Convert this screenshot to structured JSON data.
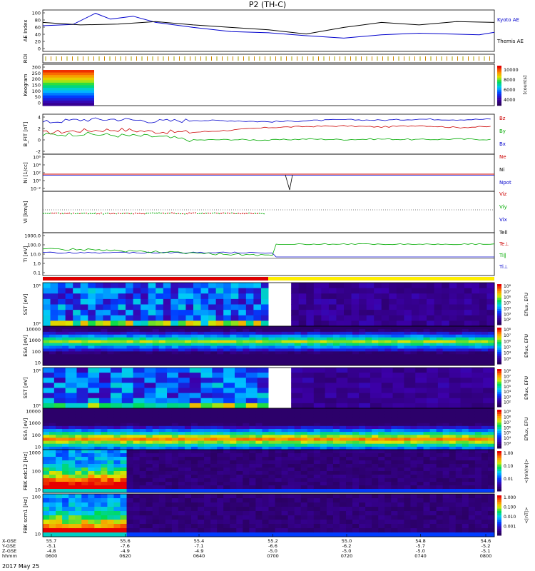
{
  "chart_data": {
    "type": "line",
    "title": "P2 (TH-C)",
    "date_label": "2017 May 25",
    "x_tick_labels": {
      "xgse": [
        "55.7",
        "55.6",
        "55.4",
        "55.2",
        "55.0",
        "54.8",
        "54.6"
      ],
      "ygse": [
        "-5.1",
        "-7.6",
        "-7.1",
        "-6.6",
        "-6.2",
        "-5.7",
        "-5.2"
      ],
      "zgse": [
        "-4.8",
        "-4.9",
        "-4.9",
        "-5.0",
        "-5.0",
        "-5.0",
        "-5.1"
      ],
      "hhmm": [
        "0600",
        "0620",
        "0640",
        "0700",
        "0720",
        "0740",
        "0800"
      ]
    },
    "x_row_labels": [
      "X-GSE",
      "Y-GSE",
      "Z-GSE",
      "hhmm"
    ],
    "panels": [
      {
        "id": "ae",
        "ylabel": "AE Index",
        "ylim": [
          0,
          100
        ],
        "y_ticks": [
          "100",
          "80",
          "60",
          "40",
          "20",
          "0"
        ],
        "series": [
          {
            "name": "Kyoto AE",
            "color": "#0000cc",
            "x": [
              0,
              8,
              14,
              18,
              24,
              30,
              40,
              50,
              60,
              70,
              80,
              90,
              100,
              108,
              116,
              120
            ],
            "y": [
              62,
              65,
              92,
              78,
              85,
              70,
              58,
              48,
              45,
              38,
              32,
              40,
              44,
              42,
              40,
              46
            ]
          },
          {
            "name": "Themis AE",
            "color": "#000000",
            "x": [
              0,
              10,
              20,
              30,
              40,
              50,
              60,
              70,
              80,
              90,
              100,
              110,
              120
            ],
            "y": [
              70,
              64,
              66,
              72,
              64,
              58,
              52,
              42,
              58,
              70,
              64,
              72,
              70
            ]
          }
        ]
      },
      {
        "id": "roi",
        "ylabel": "ROI"
      },
      {
        "id": "keogram",
        "ylabel": "Keogram",
        "y_ticks": [
          "300",
          "250",
          "200",
          "150",
          "100",
          "50",
          "0"
        ],
        "colorbar": {
          "label": "[counts]",
          "ticks": [
            "10000",
            "8000",
            "6000",
            "4000"
          ]
        }
      },
      {
        "id": "bfit",
        "ylabel": "B_FIT [nT]",
        "y_ticks": [
          "4",
          "2",
          "0",
          "-2"
        ],
        "series": [
          {
            "name": "Bz",
            "color": "#cc0000",
            "x": [
              0,
              10,
              20,
              30,
              40,
              50,
              60,
              70,
              80,
              90,
              100,
              110,
              120
            ],
            "y": [
              1.0,
              1.4,
              1.6,
              1.2,
              1.1,
              1.5,
              2.0,
              2.2,
              2.3,
              2.1,
              2.4,
              2.0,
              2.2
            ]
          },
          {
            "name": "By",
            "color": "#00aa00",
            "x": [
              0,
              10,
              20,
              30,
              40,
              50,
              60,
              70,
              80,
              90,
              100,
              110,
              120
            ],
            "y": [
              0.6,
              0.8,
              0.5,
              0.3,
              -0.4,
              -0.3,
              -0.4,
              -0.2,
              -0.3,
              -0.2,
              -0.3,
              -0.2,
              -0.3
            ]
          },
          {
            "name": "Bx",
            "color": "#0000cc",
            "x": [
              0,
              10,
              20,
              30,
              40,
              50,
              60,
              70,
              80,
              90,
              100,
              110,
              120
            ],
            "y": [
              3.0,
              3.5,
              3.6,
              3.2,
              3.4,
              3.3,
              3.1,
              3.3,
              3.5,
              3.4,
              3.6,
              3.5,
              3.6
            ]
          }
        ]
      },
      {
        "id": "ni",
        "ylabel": "Ni [1/cc]",
        "y_ticks": [
          "10⁶",
          "10⁴",
          "10²",
          "10⁰",
          "10⁻²"
        ],
        "legend": [
          "Ne",
          "Ni",
          "Npot"
        ],
        "legend_colors": [
          "#cc0000",
          "#000000",
          "#0000cc"
        ]
      },
      {
        "id": "vi",
        "ylabel": "Vi [km/s]",
        "legend": [
          "Viz",
          "Viy",
          "Vix"
        ],
        "legend_colors": [
          "#cc0000",
          "#00aa00",
          "#0000cc"
        ]
      },
      {
        "id": "ti",
        "ylabel": "Ti [eV]",
        "y_ticks": [
          "1000.0",
          "100.0",
          "10.0",
          "1.0",
          "0.1"
        ],
        "legend": [
          "Tell",
          "Te⊥",
          "Ti∥",
          "Ti⊥"
        ],
        "legend_colors": [
          "#000000",
          "#cc0000",
          "#00aa00",
          "#0000cc"
        ]
      },
      {
        "id": "sst_i",
        "ylabel": "SST [eV]",
        "y_ticks": [
          "10⁶",
          "10⁵"
        ],
        "colorbar": {
          "label": "Eflux, EFU",
          "ticks": [
            "10⁸",
            "10⁷",
            "10⁶",
            "10⁵",
            "10⁴",
            "10³",
            "10²"
          ]
        }
      },
      {
        "id": "esa_i",
        "ylabel": "ESA [eV]",
        "y_ticks": [
          "10000",
          "1000",
          "100",
          "10"
        ],
        "colorbar": {
          "label": "Eflux, EFU",
          "ticks": [
            "10⁸",
            "10⁷",
            "10⁶",
            "10⁵",
            "10⁴",
            "10³"
          ]
        }
      },
      {
        "id": "sst_e",
        "ylabel": "SST [eV]",
        "y_ticks": [
          "10⁶",
          "10⁵"
        ],
        "colorbar": {
          "label": "Eflux, EFU",
          "ticks": [
            "10⁸",
            "10⁷",
            "10⁶",
            "10⁵",
            "10⁴",
            "10³",
            "10²"
          ]
        }
      },
      {
        "id": "esa_e",
        "ylabel": "ESA [eV]",
        "y_ticks": [
          "10000",
          "1000",
          "100",
          "10"
        ],
        "colorbar": {
          "label": "Eflux, EFU",
          "ticks": [
            "10⁹",
            "10⁸",
            "10⁷",
            "10⁶",
            "10⁵",
            "10⁴",
            "10³"
          ]
        }
      },
      {
        "id": "fbk_e",
        "ylabel": "FBK edc12 [Hz]",
        "y_ticks": [
          "1000",
          "100",
          "10"
        ],
        "colorbar": {
          "label": "<|mV/m|>",
          "ticks": [
            "1.00",
            "0.10",
            "0.01"
          ]
        }
      },
      {
        "id": "fbk_b",
        "ylabel": "FBK scm1 [Hz]",
        "y_ticks": [
          "100",
          "10"
        ],
        "colorbar": {
          "label": "<|nT|>",
          "ticks": [
            "1.000",
            "0.100",
            "0.010",
            "0.001"
          ]
        }
      }
    ]
  }
}
